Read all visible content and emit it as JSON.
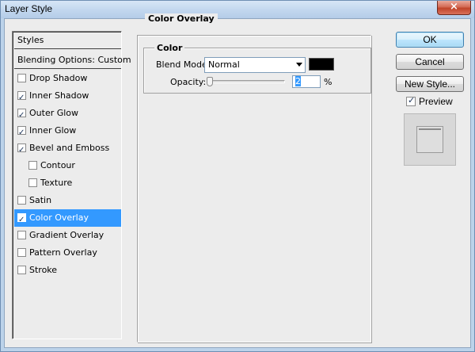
{
  "window": {
    "title": "Layer Style",
    "close_glyph": "×"
  },
  "styles": {
    "header": "Styles",
    "blending": "Blending Options: Custom",
    "items": [
      {
        "label": "Drop Shadow",
        "checked": false,
        "indent": false
      },
      {
        "label": "Inner Shadow",
        "checked": true,
        "indent": false
      },
      {
        "label": "Outer Glow",
        "checked": true,
        "indent": false
      },
      {
        "label": "Inner Glow",
        "checked": true,
        "indent": false
      },
      {
        "label": "Bevel and Emboss",
        "checked": true,
        "indent": false
      },
      {
        "label": "Contour",
        "checked": false,
        "indent": true
      },
      {
        "label": "Texture",
        "checked": false,
        "indent": true
      },
      {
        "label": "Satin",
        "checked": false,
        "indent": false
      },
      {
        "label": "Color Overlay",
        "checked": true,
        "indent": false,
        "selected": true
      },
      {
        "label": "Gradient Overlay",
        "checked": false,
        "indent": false
      },
      {
        "label": "Pattern Overlay",
        "checked": false,
        "indent": false
      },
      {
        "label": "Stroke",
        "checked": false,
        "indent": false
      }
    ]
  },
  "panel": {
    "title": "Color Overlay",
    "group_title": "Color",
    "blend_mode_label": "Blend Mode:",
    "blend_mode_value": "Normal",
    "overlay_color": "#000000",
    "opacity_label": "Opacity:",
    "opacity_value": "2",
    "opacity_unit": "%"
  },
  "buttons": {
    "ok": "OK",
    "cancel": "Cancel",
    "new_style": "New Style...",
    "preview_label": "Preview",
    "preview_checked": true
  }
}
